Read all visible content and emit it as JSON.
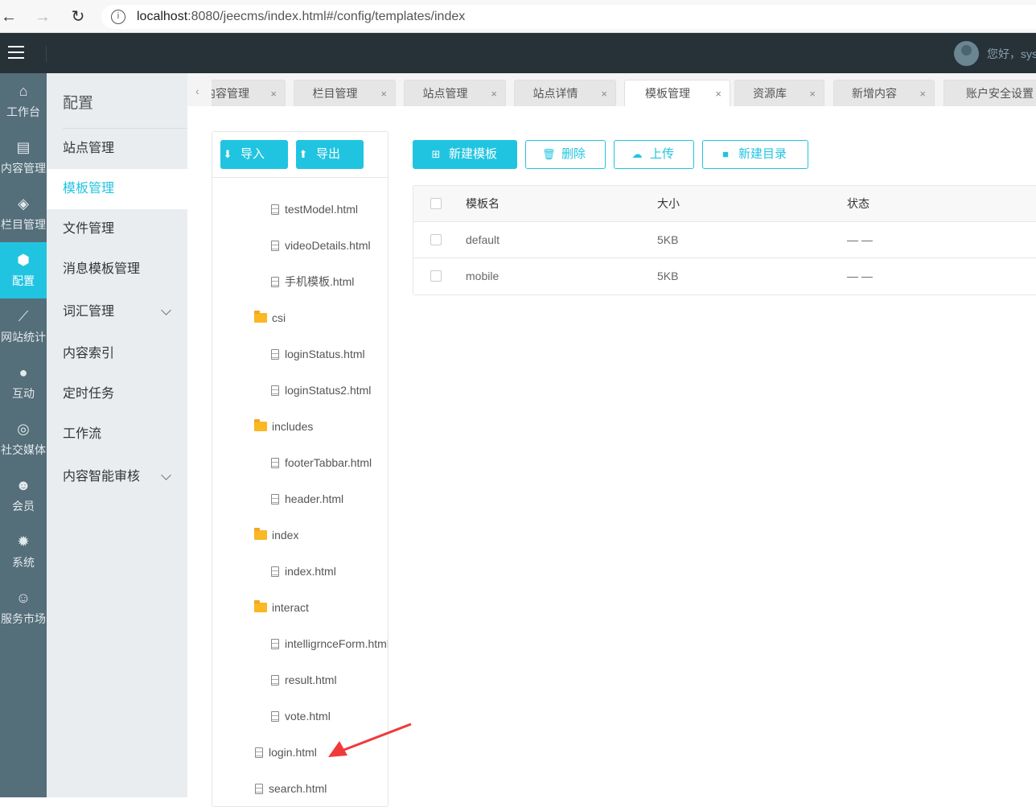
{
  "browser": {
    "url_host": "localhost",
    "url_rest": ":8080/jeecms/index.html#/config/templates/index"
  },
  "header": {
    "greeting": "您好，sys"
  },
  "rail": [
    {
      "label": "工作台",
      "icon": "home-icon"
    },
    {
      "label": "内容管理",
      "icon": "document-icon"
    },
    {
      "label": "栏目管理",
      "icon": "layers-icon"
    },
    {
      "label": "配置",
      "icon": "cube-icon",
      "active": true
    },
    {
      "label": "网站统计",
      "icon": "chart-line-icon"
    },
    {
      "label": "互动",
      "icon": "chat-icon"
    },
    {
      "label": "社交媒体",
      "icon": "social-icon"
    },
    {
      "label": "会员",
      "icon": "member-icon"
    },
    {
      "label": "系统",
      "icon": "gear-icon"
    },
    {
      "label": "服务市场",
      "icon": "service-icon"
    }
  ],
  "submenu": {
    "title": "配置",
    "items": [
      {
        "label": "站点管理"
      },
      {
        "label": "模板管理",
        "active": true
      },
      {
        "label": "文件管理"
      },
      {
        "label": "消息模板管理"
      },
      {
        "label": "词汇管理",
        "expandable": true
      },
      {
        "label": "内容索引"
      },
      {
        "label": "定时任务"
      },
      {
        "label": "工作流"
      },
      {
        "label": "内容智能审核",
        "expandable": true
      }
    ]
  },
  "tabs": [
    {
      "label": "内容管理"
    },
    {
      "label": "栏目管理"
    },
    {
      "label": "站点管理"
    },
    {
      "label": "站点详情"
    },
    {
      "label": "模板管理",
      "active": true
    },
    {
      "label": "资源库"
    },
    {
      "label": "新增内容"
    },
    {
      "label": "账户安全设置"
    }
  ],
  "tree": {
    "import_label": "导入",
    "export_label": "导出",
    "nodes": [
      {
        "name": "testModel.html",
        "type": "file",
        "level": 2
      },
      {
        "name": "videoDetails.html",
        "type": "file",
        "level": 2
      },
      {
        "name": "手机模板.html",
        "type": "file",
        "level": 2
      },
      {
        "name": "csi",
        "type": "folder",
        "level": 1
      },
      {
        "name": "loginStatus.html",
        "type": "file",
        "level": 2
      },
      {
        "name": "loginStatus2.html",
        "type": "file",
        "level": 2
      },
      {
        "name": "includes",
        "type": "folder",
        "level": 1
      },
      {
        "name": "footerTabbar.html",
        "type": "file",
        "level": 2
      },
      {
        "name": "header.html",
        "type": "file",
        "level": 2
      },
      {
        "name": "index",
        "type": "folder",
        "level": 1
      },
      {
        "name": "index.html",
        "type": "file",
        "level": 2
      },
      {
        "name": "interact",
        "type": "folder",
        "level": 1
      },
      {
        "name": "intelligrnceForm.html",
        "type": "file",
        "level": 2
      },
      {
        "name": "result.html",
        "type": "file",
        "level": 2
      },
      {
        "name": "vote.html",
        "type": "file",
        "level": 2
      },
      {
        "name": "login.html",
        "type": "file",
        "level": 1
      },
      {
        "name": "search.html",
        "type": "file",
        "level": 1
      }
    ]
  },
  "toolbar": {
    "new_template": "新建模板",
    "delete": "删除",
    "upload": "上传",
    "new_dir": "新建目录"
  },
  "table": {
    "headers": [
      "模板名",
      "大小",
      "状态"
    ],
    "rows": [
      {
        "name": "default",
        "size": "5KB",
        "status": "— —"
      },
      {
        "name": "mobile",
        "size": "5KB",
        "status": "— —"
      }
    ]
  },
  "colors": {
    "accent": "#21c4e0",
    "header": "#263238",
    "rail": "#546e7a",
    "annotation": "#f03a3a"
  }
}
